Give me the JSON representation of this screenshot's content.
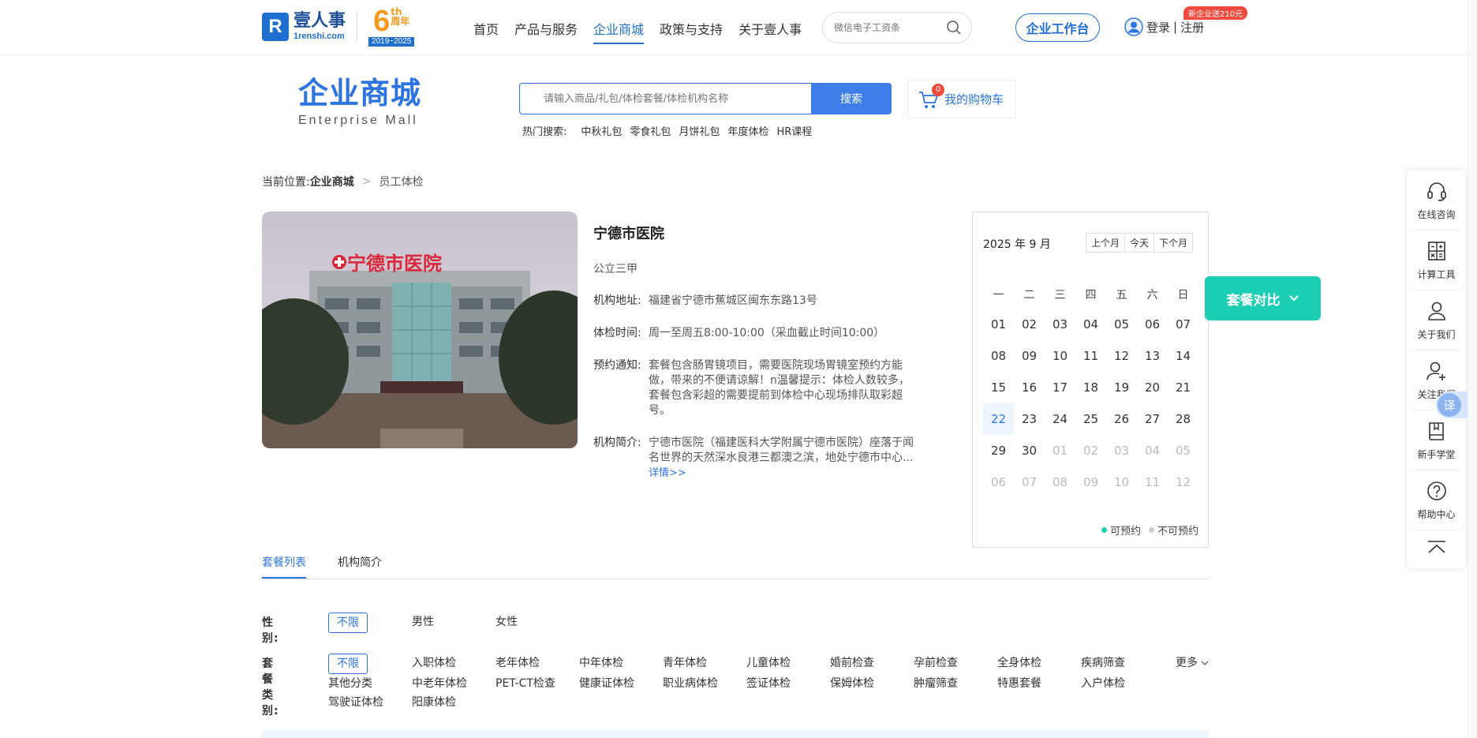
{
  "header": {
    "logo_cn": "壹人事",
    "logo_en": "1renshi.com",
    "anniv_number": "6",
    "anniv_th": "th",
    "anniv_label": "周年",
    "anniv_years": "2019~2025",
    "nav": [
      "首页",
      "产品与服务",
      "企业商城",
      "政策与支持",
      "关于壹人事"
    ],
    "search_placeholder": "微信电子工资条",
    "workbench": "企业工作台",
    "login": "登录",
    "register": "注册",
    "login_sep": "|",
    "promo": "新企业送210元"
  },
  "mall": {
    "logo_cn": "企业商城",
    "logo_en": "Enterprise Mall",
    "search_placeholder": "请输入商品/礼包/体检套餐/体检机构名称",
    "search_button": "搜索",
    "hot_label": "热门搜索:",
    "hot_items": [
      "中秋礼包",
      "零食礼包",
      "月饼礼包",
      "年度体检",
      "HR课程"
    ],
    "cart_label": "我的购物车",
    "cart_count": "0"
  },
  "breadcrumb": {
    "prefix": "当前位置:",
    "level1": "企业商城",
    "sep": ">",
    "level2": "员工体检"
  },
  "hospital": {
    "name": "宁德市医院",
    "level": "公立三甲",
    "address_label": "机构地址:",
    "address": "福建省宁德市蕉城区闽东东路13号",
    "time_label": "体检时间:",
    "time": "周一至周五8:00-10:00（采血截止时间10:00）",
    "notice_label": "预约通知:",
    "notice": "套餐包含肠胃镜项目，需要医院现场胃镜室预约方能做，带来的不便请谅解！n温馨提示：体检人数较多，套餐包含彩超的需要提前到体检中心现场排队取彩超号。",
    "intro_label": "机构简介:",
    "intro": "宁德市医院（福建医科大学附属宁德市医院）座落于闻名世界的天然深水良港三都澳之滨，地处宁德市中心...",
    "detail_link": "详情>>",
    "photo_sign": "宁德市医院"
  },
  "calendar": {
    "title": "2025 年 9 月",
    "buttons": [
      "上个月",
      "今天",
      "下个月"
    ],
    "weekdays": [
      "一",
      "二",
      "三",
      "四",
      "五",
      "六",
      "日"
    ],
    "days": [
      {
        "d": "01",
        "t": "cur"
      },
      {
        "d": "02",
        "t": "cur"
      },
      {
        "d": "03",
        "t": "cur"
      },
      {
        "d": "04",
        "t": "cur"
      },
      {
        "d": "05",
        "t": "cur"
      },
      {
        "d": "06",
        "t": "cur"
      },
      {
        "d": "07",
        "t": "cur"
      },
      {
        "d": "08",
        "t": "cur"
      },
      {
        "d": "09",
        "t": "cur"
      },
      {
        "d": "10",
        "t": "cur"
      },
      {
        "d": "11",
        "t": "cur"
      },
      {
        "d": "12",
        "t": "cur"
      },
      {
        "d": "13",
        "t": "cur"
      },
      {
        "d": "14",
        "t": "cur"
      },
      {
        "d": "15",
        "t": "cur"
      },
      {
        "d": "16",
        "t": "cur"
      },
      {
        "d": "17",
        "t": "cur"
      },
      {
        "d": "18",
        "t": "cur"
      },
      {
        "d": "19",
        "t": "cur"
      },
      {
        "d": "20",
        "t": "cur"
      },
      {
        "d": "21",
        "t": "cur"
      },
      {
        "d": "22",
        "t": "today"
      },
      {
        "d": "23",
        "t": "cur"
      },
      {
        "d": "24",
        "t": "cur"
      },
      {
        "d": "25",
        "t": "cur"
      },
      {
        "d": "26",
        "t": "cur"
      },
      {
        "d": "27",
        "t": "cur"
      },
      {
        "d": "28",
        "t": "cur"
      },
      {
        "d": "29",
        "t": "cur"
      },
      {
        "d": "30",
        "t": "cur"
      },
      {
        "d": "01",
        "t": "other"
      },
      {
        "d": "02",
        "t": "other"
      },
      {
        "d": "03",
        "t": "other"
      },
      {
        "d": "04",
        "t": "other"
      },
      {
        "d": "05",
        "t": "other"
      },
      {
        "d": "06",
        "t": "other"
      },
      {
        "d": "07",
        "t": "other"
      },
      {
        "d": "08",
        "t": "other"
      },
      {
        "d": "09",
        "t": "other"
      },
      {
        "d": "10",
        "t": "other"
      },
      {
        "d": "11",
        "t": "other"
      },
      {
        "d": "12",
        "t": "other"
      }
    ],
    "legend_available": "可预约",
    "legend_unavailable": "不可预约",
    "color_available": "#1ccfb4",
    "color_unavailable": "#cccccc"
  },
  "compare_button": "套餐对比",
  "tabs": [
    "套餐列表",
    "机构简介"
  ],
  "filters": {
    "gender_label": "性　　别:",
    "gender_options": [
      "不限",
      "男性",
      "女性"
    ],
    "package_label": "套餐类别:",
    "package_options": [
      "不限",
      "入职体检",
      "老年体检",
      "中年体检",
      "青年体检",
      "儿童体检",
      "婚前检查",
      "孕前检查",
      "全身体检",
      "疾病筛查",
      "其他分类",
      "中老年体检",
      "PET-CT检查",
      "健康证体检",
      "职业病体检",
      "签证体检",
      "保姆体检",
      "肿瘤筛查",
      "特惠套餐",
      "入户体检",
      "驾驶证体检",
      "阳康体检"
    ],
    "more": "更多"
  },
  "sidebar": {
    "items": [
      {
        "label": "在线咨询",
        "icon": "headset-icon"
      },
      {
        "label": "计算工具",
        "icon": "calculator-icon"
      },
      {
        "label": "关于我们",
        "icon": "user-icon"
      },
      {
        "label": "关注我们",
        "icon": "user-plus-icon"
      },
      {
        "label": "新手学堂",
        "icon": "book-icon"
      },
      {
        "label": "帮助中心",
        "icon": "question-icon"
      }
    ],
    "translate": "译"
  },
  "colors": {
    "brand_blue": "#2d74e0",
    "accent_teal": "#1ccfb4",
    "promo_red": "#f04a3d",
    "anniv_orange": "#f39a1f"
  }
}
